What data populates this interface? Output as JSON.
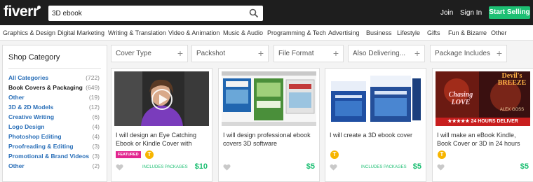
{
  "header": {
    "logo": "fiverr",
    "search_value": "3D ebook",
    "join": "Join",
    "sign_in": "Sign In",
    "start_selling": "Start Selling"
  },
  "categories": [
    "Graphics & Design",
    "Digital Marketing",
    "Writing & Translation",
    "Video & Animation",
    "Music & Audio",
    "Programming & Tech",
    "Advertising",
    "Business",
    "Lifestyle",
    "Gifts",
    "Fun & Bizarre",
    "Other"
  ],
  "sidebar": {
    "title": "Shop Category",
    "items": [
      {
        "label": "All Categories",
        "count": "(722)"
      },
      {
        "label": "Book Covers & Packaging",
        "count": "(649)"
      },
      {
        "label": "Other",
        "count": "(19)"
      },
      {
        "label": "3D & 2D Models",
        "count": "(12)"
      },
      {
        "label": "Creative Writing",
        "count": "(6)"
      },
      {
        "label": "Logo Design",
        "count": "(4)"
      },
      {
        "label": "Photoshop Editing",
        "count": "(4)"
      },
      {
        "label": "Proofreading & Editing",
        "count": "(3)"
      },
      {
        "label": "Promotional & Brand Videos",
        "count": "(3)"
      },
      {
        "label": "Other",
        "count": "(2)"
      }
    ]
  },
  "filters": [
    "Cover Type",
    "Packshot",
    "File Format",
    "Also Delivering...",
    "Package Includes"
  ],
  "gigs": [
    {
      "title": "I will design an Eye Catching Ebook or Kindle Cover with",
      "featured": "FEATURED",
      "level_badge": "T",
      "packages": "INCLUDES PACKAGES",
      "price": "$10"
    },
    {
      "title": "I will design professional ebook covers 3D software",
      "price": "$5"
    },
    {
      "title": "I will create a 3D ebook cover",
      "level_badge": "T",
      "packages": "INCLUDES PACKAGES",
      "price": "$5"
    },
    {
      "title": "I will make an eBook Kindle, Book Cover or 3D in 24 hours",
      "level_badge": "T",
      "price": "$5"
    }
  ],
  "thumbnail_text": {
    "book1_top": "THE BACKLINKS BARRAGE",
    "book3_top": "From Newbie to Millionaire",
    "book4_top": "Devil's BREEZE",
    "book4_mid": "Chasing LOVE",
    "book4_author": "ALEX GOSS",
    "book4_banner": "★★★★★ 24 HOURS DELIVER"
  },
  "colors": {
    "brand_green": "#1dbf73",
    "link_blue": "#2a6fb8",
    "featured_pink": "#e2268f",
    "level_gold": "#f7b500"
  }
}
